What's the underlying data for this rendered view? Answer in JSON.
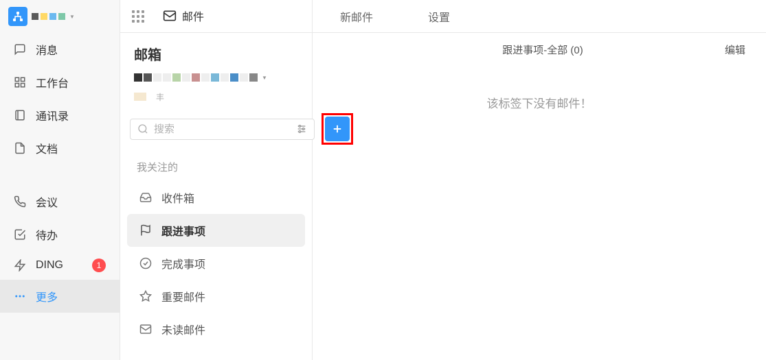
{
  "leftNav": {
    "items": [
      {
        "name": "消息"
      },
      {
        "name": "工作台"
      },
      {
        "name": "通讯录"
      },
      {
        "name": "文档"
      }
    ],
    "items2": [
      {
        "name": "会议"
      },
      {
        "name": "待办"
      },
      {
        "name": "DING",
        "badge": "1"
      },
      {
        "name": "更多"
      }
    ]
  },
  "tabs": {
    "mail": "邮件",
    "newMail": "新邮件",
    "settings": "设置"
  },
  "mailbox": {
    "title": "邮箱",
    "search_placeholder": "搜索",
    "section_label": "我关注的",
    "folders": [
      {
        "name": "收件箱"
      },
      {
        "name": "跟进事项"
      },
      {
        "name": "完成事项"
      },
      {
        "name": "重要邮件"
      },
      {
        "name": "未读邮件"
      }
    ]
  },
  "content": {
    "header_title": "跟进事项-全部 (0)",
    "edit": "编辑",
    "empty": "该标签下没有邮件！"
  }
}
